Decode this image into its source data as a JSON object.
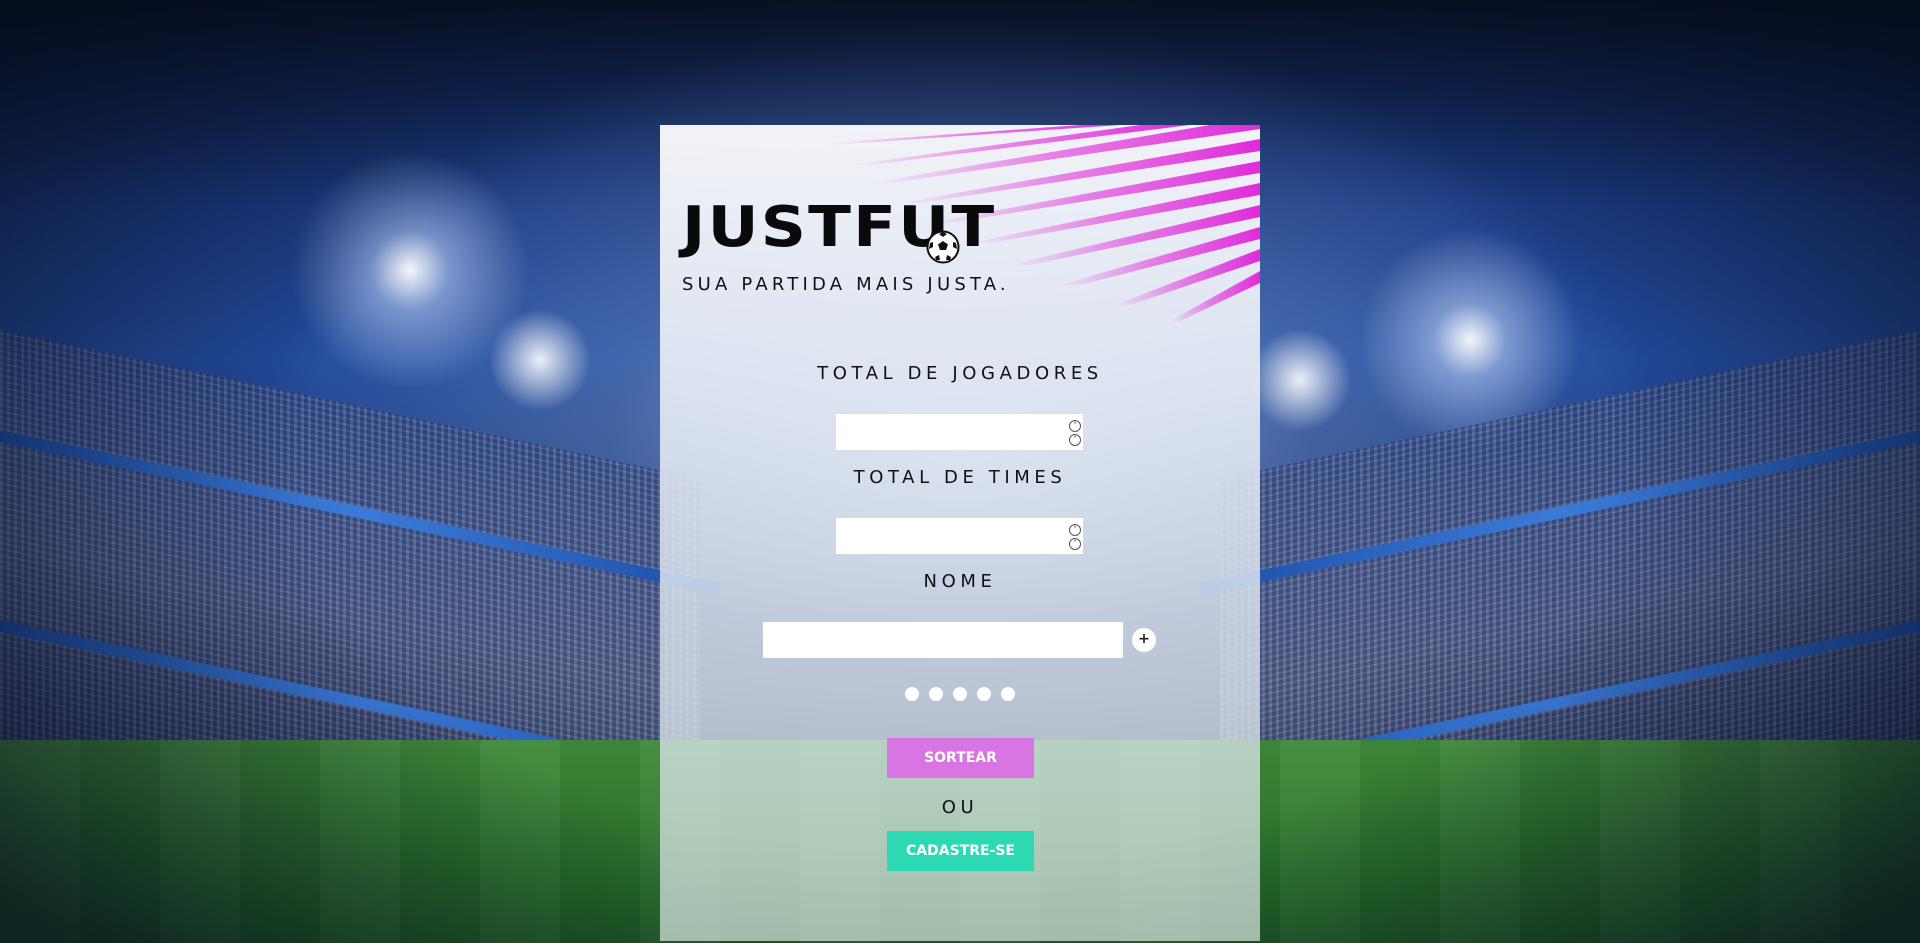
{
  "brand": {
    "logo": "JUSTFUT",
    "tagline": "SUA PARTIDA MAIS JUSTA.",
    "logo_icon": "soccer-ball-icon"
  },
  "form": {
    "total_jogadores_label": "TOTAL DE JOGADORES",
    "total_jogadores_value": "",
    "total_times_label": "TOTAL DE TIMES",
    "total_times_value": "",
    "nome_label": "NOME",
    "nome_value": "",
    "add_label": "+",
    "dots_count": 5
  },
  "actions": {
    "sortear_label": "SORTEAR",
    "ou_label": "OU",
    "cadastre_label": "CADASTRE-SE"
  },
  "colors": {
    "sortear": "#d975e2",
    "cadastre": "#2dd9b2",
    "stripes": "#e02bd9"
  }
}
